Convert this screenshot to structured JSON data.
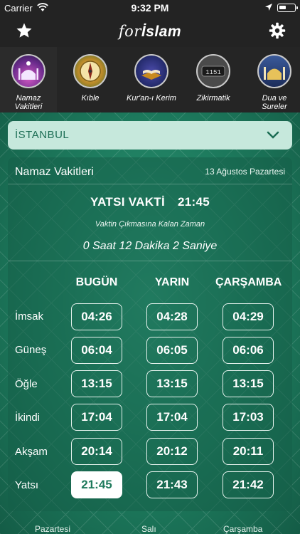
{
  "status_bar": {
    "carrier": "Carrier",
    "time": "9:32 PM"
  },
  "header": {
    "logo_prefix": "for",
    "logo_main": "İslam"
  },
  "shortcuts": [
    {
      "label": "Namaz Vakitleri",
      "icon": "mosque-icon"
    },
    {
      "label": "Kıble",
      "icon": "compass-icon"
    },
    {
      "label": "Kur'an-ı Kerim",
      "icon": "quran-icon"
    },
    {
      "label": "Zikirmatik",
      "icon": "counter-icon"
    },
    {
      "label": "Dua ve Sureler",
      "icon": "mosque-dome-icon"
    }
  ],
  "city": {
    "selected": "İSTANBUL"
  },
  "card": {
    "title": "Namaz Vakitleri",
    "date": "13 Ağustos Pazartesi",
    "next_prayer_name": "YATSI VAKTİ",
    "next_prayer_time": "21:45",
    "remaining_label": "Vaktin Çıkmasına Kalan Zaman",
    "remaining_value": "0 Saat 12 Dakika 2 Saniye",
    "columns": [
      "BUGÜN",
      "YARIN",
      "ÇARŞAMBA"
    ],
    "rows": [
      {
        "name": "İmsak",
        "times": [
          "04:26",
          "04:28",
          "04:29"
        ]
      },
      {
        "name": "Güneş",
        "times": [
          "06:04",
          "06:05",
          "06:06"
        ]
      },
      {
        "name": "Öğle",
        "times": [
          "13:15",
          "13:15",
          "13:15"
        ]
      },
      {
        "name": "İkindi",
        "times": [
          "17:04",
          "17:04",
          "17:03"
        ]
      },
      {
        "name": "Akşam",
        "times": [
          "20:14",
          "20:12",
          "20:11"
        ]
      },
      {
        "name": "Yatsı",
        "times": [
          "21:45",
          "21:43",
          "21:42"
        ]
      }
    ],
    "active_cell": "Yatsı - BUGÜN"
  },
  "bottom_tabs": [
    "Pazartesi",
    "Salı",
    "Çarşamba"
  ],
  "colors": {
    "accent": "#1f7a5c",
    "dropdown_bg": "#c6e8dc",
    "header_bg": "#232323"
  }
}
